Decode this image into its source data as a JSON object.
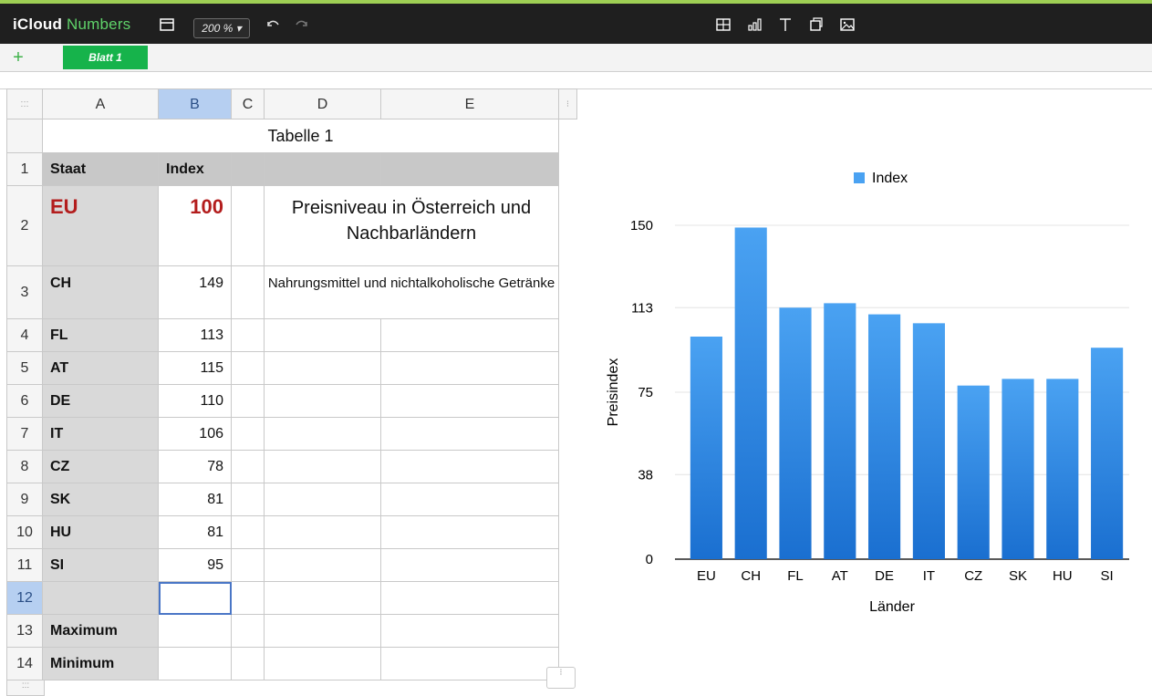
{
  "app": {
    "brand_primary": "iCloud",
    "brand_secondary": "Numbers",
    "zoom_label": "200 % ▾",
    "accent": "#16b34b"
  },
  "sheets": [
    {
      "label": "Blatt 1",
      "active": true
    }
  ],
  "spreadsheet": {
    "table_title": "Tabelle 1",
    "columns": [
      "A",
      "B",
      "C",
      "D",
      "E"
    ],
    "rows": [
      {
        "n": "1",
        "A": "Staat",
        "B": "Index",
        "D": "Preisniveau in Österreich und Nachbarländern"
      },
      {
        "n": "2",
        "A": "EU",
        "B": "100"
      },
      {
        "n": "3",
        "A": "CH",
        "B": "149",
        "D": "Nahrungsmittel und nichtalkoholische Getränke"
      },
      {
        "n": "4",
        "A": "FL",
        "B": "113"
      },
      {
        "n": "5",
        "A": "AT",
        "B": "115"
      },
      {
        "n": "6",
        "A": "DE",
        "B": "110"
      },
      {
        "n": "7",
        "A": "IT",
        "B": "106"
      },
      {
        "n": "8",
        "A": "CZ",
        "B": "78"
      },
      {
        "n": "9",
        "A": "SK",
        "B": "81"
      },
      {
        "n": "10",
        "A": "HU",
        "B": "81"
      },
      {
        "n": "11",
        "A": "SI",
        "B": "95"
      },
      {
        "n": "12",
        "A": "",
        "B": ""
      },
      {
        "n": "13",
        "A": "Maximum",
        "B": ""
      },
      {
        "n": "14",
        "A": "Minimum",
        "B": ""
      }
    ],
    "selected_cell": "B12",
    "handle_glyph": ":::"
  },
  "chart_data": {
    "type": "bar",
    "categories": [
      "EU",
      "CH",
      "FL",
      "AT",
      "DE",
      "IT",
      "CZ",
      "SK",
      "HU",
      "SI"
    ],
    "series": [
      {
        "name": "Index",
        "values": [
          100,
          149,
          113,
          115,
          110,
          106,
          78,
          81,
          81,
          95
        ]
      }
    ],
    "xlabel": "Länder",
    "ylabel": "Preisindex",
    "ylim": [
      0,
      150
    ],
    "yticks": [
      "0",
      "38",
      "75",
      "113",
      "150"
    ],
    "legend_position": "top",
    "bar_color_top": "#4aa2f2",
    "bar_color_bottom": "#1a6fd0",
    "grid": true
  }
}
